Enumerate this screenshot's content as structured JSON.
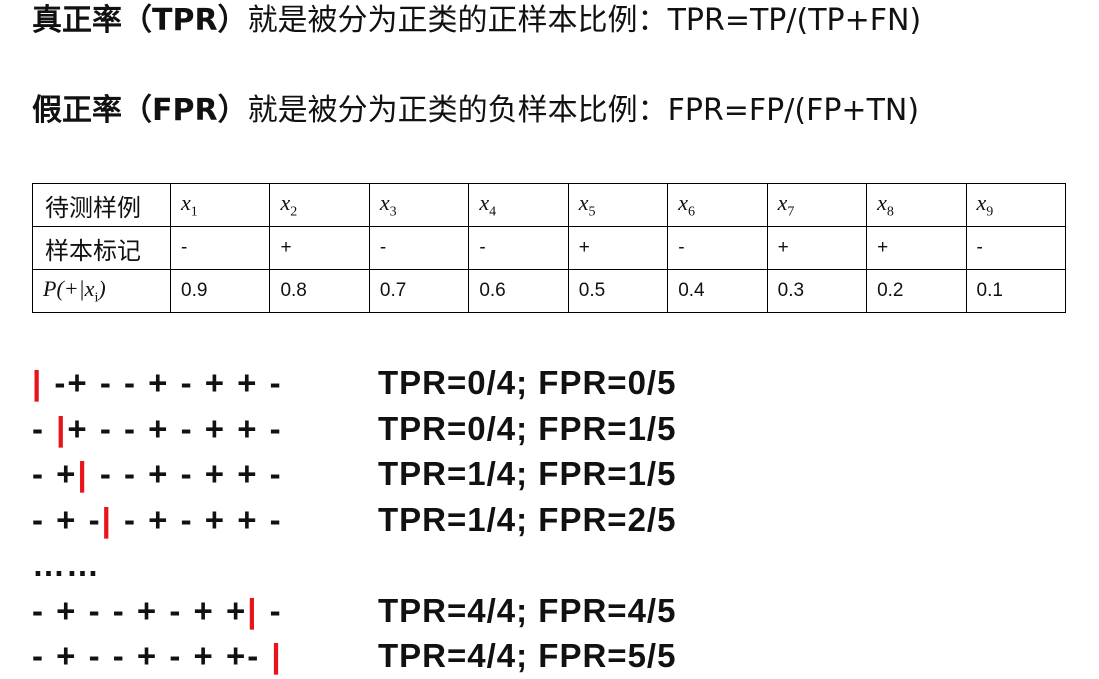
{
  "definitions": [
    {
      "term": "真正率",
      "abbr": "（TPR）",
      "desc": "就是被分为正类的正样本比例：",
      "formula": "TPR=TP/(TP+FN)"
    },
    {
      "term": "假正率",
      "abbr": "（FPR）",
      "desc": "就是被分为正类的负样本比例：",
      "formula": "FPR=FP/(FP+TN)"
    }
  ],
  "table": {
    "row_headers": [
      "待测样例",
      "样本标记",
      "P(+|x"
    ],
    "row_header_sub": "i",
    "row_header_tail": ")",
    "sample_var": "x",
    "sample_indices": [
      "1",
      "2",
      "3",
      "4",
      "5",
      "6",
      "7",
      "8",
      "9"
    ],
    "labels": [
      "-",
      "+",
      "-",
      "-",
      "+",
      "-",
      "+",
      "+",
      "-"
    ],
    "probabilities": [
      "0.9",
      "0.8",
      "0.7",
      "0.6",
      "0.5",
      "0.4",
      "0.3",
      "0.2",
      "0.1"
    ]
  },
  "threshold_steps": [
    {
      "before": "",
      "cut": "|",
      "after": " -+ - - + - + + -",
      "rates": "TPR=0/4; FPR=0/5"
    },
    {
      "before": "- ",
      "cut": "|",
      "after": "+ - - + - + + -",
      "rates": "TPR=0/4; FPR=1/5"
    },
    {
      "before": "- +",
      "cut": "|",
      "after": " - - + - + + -",
      "rates": "TPR=1/4; FPR=1/5"
    },
    {
      "before": "- + -",
      "cut": "|",
      "after": " - + - + + -",
      "rates": "TPR=1/4; FPR=2/5"
    },
    {
      "ellipsis": "……"
    },
    {
      "before": "- + - - + - + +",
      "cut": "|",
      "after": " -",
      "rates": "TPR=4/4; FPR=4/5"
    },
    {
      "before": "- + - - + - + +- ",
      "cut": "|",
      "after": "",
      "rates": "TPR=4/4; FPR=5/5"
    }
  ],
  "colors": {
    "cut_marker": "#e8141a",
    "text": "#111111"
  }
}
